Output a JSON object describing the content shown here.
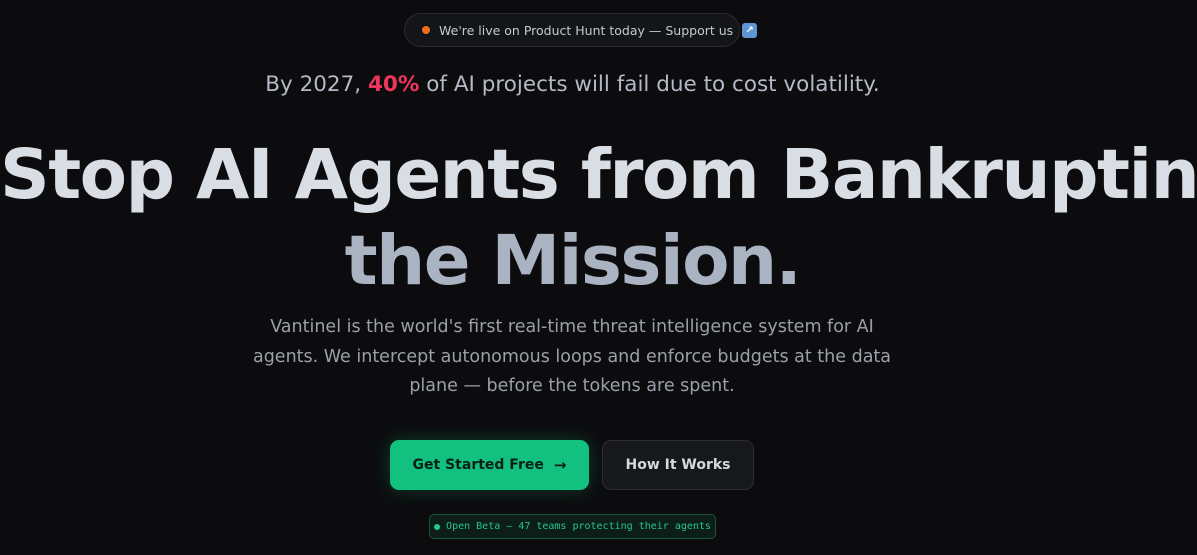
{
  "announcement": {
    "text": "We're live on Product Hunt today — Support us",
    "arrow_icon": "↗",
    "dot_color": "#f26d21"
  },
  "stat": {
    "prefix": "By 2027,",
    "highlight": "40%",
    "suffix": "of AI projects will fail due to cost volatility.",
    "highlight_color": "#f0355d"
  },
  "hero": {
    "headline_line1": "Stop AI Agents from Bankrupting",
    "headline_line2": "the Mission.",
    "description": "Vantinel is the world's first real-time threat intelligence system for AI agents. We intercept autonomous loops and enforce budgets at the data plane — before the tokens are spent."
  },
  "cta": {
    "primary_label": "Get Started Free",
    "primary_icon": "→",
    "secondary_label": "How It Works",
    "accent_color": "#12c07f"
  },
  "beta_badge": {
    "text": "Open Beta — 47 teams protecting their agents"
  }
}
